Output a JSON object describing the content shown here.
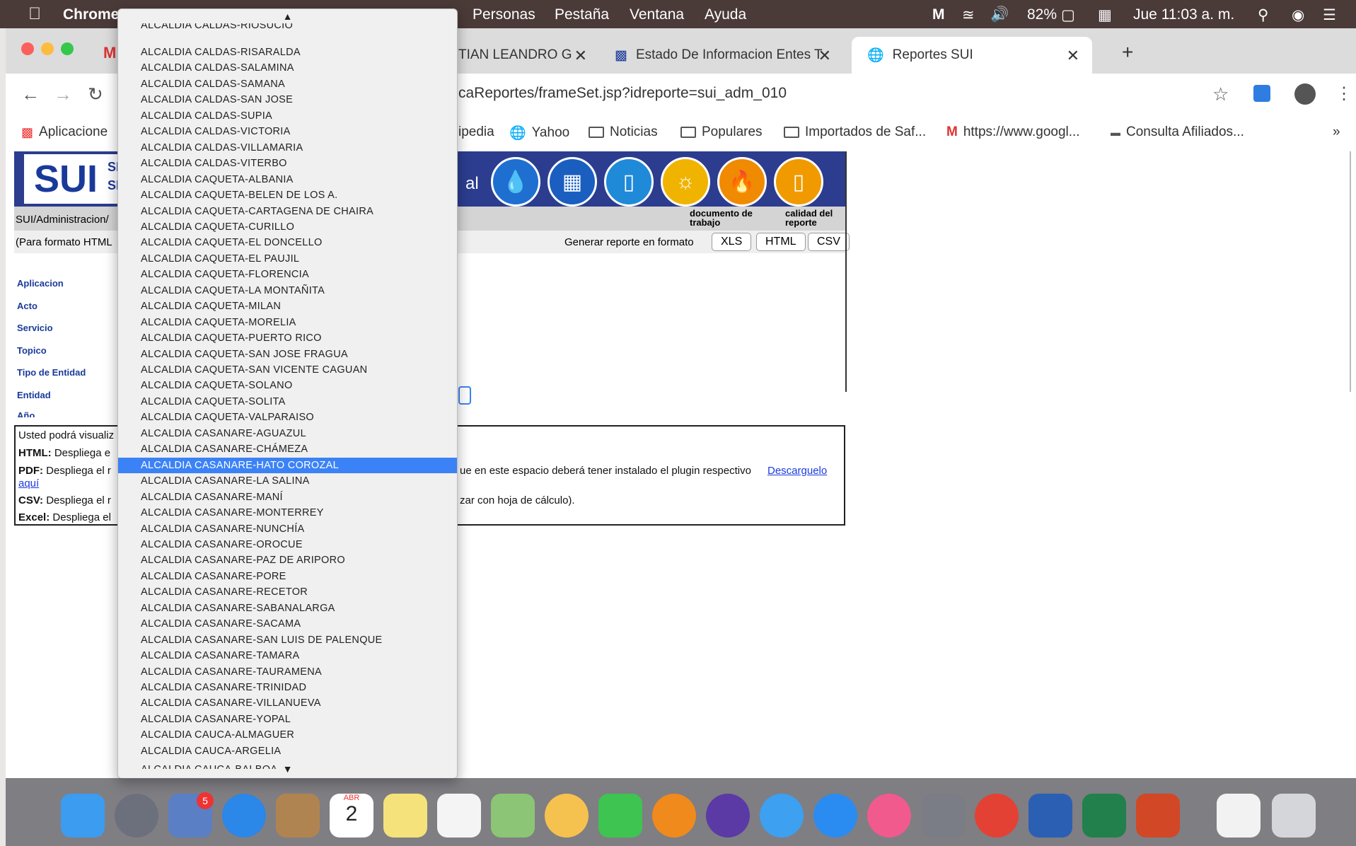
{
  "menubar": {
    "app_name": "Chrome",
    "menus": [
      "Personas",
      "Pestaña",
      "Ventana",
      "Ayuda"
    ],
    "battery": "82%",
    "datetime": "Jue 11:03 a. m."
  },
  "tabs": [
    {
      "label": "TIAN LEANDRO G"
    },
    {
      "label": "Estado De Informacion Entes T"
    },
    {
      "label": "Reportes SUI"
    }
  ],
  "address": {
    "url": "caReportes/frameSet.jsp?idreporte=sui_adm_010"
  },
  "bookmarks": [
    "Aplicacione",
    "ipedia",
    "Yahoo",
    "Noticias",
    "Populares",
    "Importados de Saf...",
    "https://www.googl...",
    "Consulta Afiliados..."
  ],
  "page": {
    "logo_text": "SUI",
    "logo_sub1": "SIS",
    "logo_sub2": "SE",
    "header_text": "al",
    "breadcrumb": "SUI/Administracion/",
    "format_note": "(Para formato HTML",
    "generate_label": "Generar reporte en formato",
    "formats": [
      "XLS",
      "HTML",
      "CSV"
    ],
    "doc_trabajo": "documento de trabajo",
    "calidad": "calidad del reporte",
    "fields": [
      "Aplicacion",
      "Acto",
      "Servicio",
      "Topico",
      "Tipo de Entidad",
      "Entidad",
      "Año"
    ],
    "info": {
      "line1": "Usted podrá visualiz",
      "html_label": "HTML:",
      "html_text": "Despliega e",
      "pdf_label": "PDF:",
      "pdf_text": "Despliega el r",
      "pdf_rest": "ue en este espacio deberá tener instalado el plugin respectivo",
      "download_link": "Descarguelo",
      "aqui_link": "aquí",
      "csv_label": "CSV:",
      "csv_text": "Despliega el r",
      "csv_rest": "zar con hoja de cálculo).",
      "excel_label": "Excel:",
      "excel_text": "Despliega el"
    }
  },
  "dropdown": {
    "top_cut": "ALCALDIA CALDAS-RIOSUCIO",
    "items": [
      "ALCALDIA CALDAS-RISARALDA",
      "ALCALDIA CALDAS-SALAMINA",
      "ALCALDIA CALDAS-SAMANA",
      "ALCALDIA CALDAS-SAN JOSE",
      "ALCALDIA CALDAS-SUPIA",
      "ALCALDIA CALDAS-VICTORIA",
      "ALCALDIA CALDAS-VILLAMARIA",
      "ALCALDIA CALDAS-VITERBO",
      "ALCALDIA CAQUETA-ALBANIA",
      "ALCALDIA CAQUETA-BELEN DE LOS A.",
      "ALCALDIA CAQUETA-CARTAGENA DE CHAIRA",
      "ALCALDIA CAQUETA-CURILLO",
      "ALCALDIA CAQUETA-EL DONCELLO",
      "ALCALDIA CAQUETA-EL PAUJIL",
      "ALCALDIA CAQUETA-FLORENCIA",
      "ALCALDIA CAQUETA-LA MONTAÑITA",
      "ALCALDIA CAQUETA-MILAN",
      "ALCALDIA CAQUETA-MORELIA",
      "ALCALDIA CAQUETA-PUERTO RICO",
      "ALCALDIA CAQUETA-SAN JOSE FRAGUA",
      "ALCALDIA CAQUETA-SAN VICENTE CAGUAN",
      "ALCALDIA CAQUETA-SOLANO",
      "ALCALDIA CAQUETA-SOLITA",
      "ALCALDIA CAQUETA-VALPARAISO",
      "ALCALDIA CASANARE-AGUAZUL",
      "ALCALDIA CASANARE-CHÁMEZA",
      "ALCALDIA CASANARE-HATO COROZAL",
      "ALCALDIA CASANARE-LA SALINA",
      "ALCALDIA CASANARE-MANÍ",
      "ALCALDIA CASANARE-MONTERREY",
      "ALCALDIA CASANARE-NUNCHÍA",
      "ALCALDIA CASANARE-OROCUE",
      "ALCALDIA CASANARE-PAZ DE ARIPORO",
      "ALCALDIA CASANARE-PORE",
      "ALCALDIA CASANARE-RECETOR",
      "ALCALDIA CASANARE-SABANALARGA",
      "ALCALDIA CASANARE-SACAMA",
      "ALCALDIA CASANARE-SAN LUIS DE PALENQUE",
      "ALCALDIA CASANARE-TAMARA",
      "ALCALDIA CASANARE-TAURAMENA",
      "ALCALDIA CASANARE-TRINIDAD",
      "ALCALDIA CASANARE-VILLANUEVA",
      "ALCALDIA CASANARE-YOPAL",
      "ALCALDIA CAUCA-ALMAGUER",
      "ALCALDIA CAUCA-ARGELIA"
    ],
    "bottom_cut": "ALCALDIA CAUCA-BALBOA",
    "selected": "ALCALDIA CASANARE-HATO COROZAL"
  },
  "dock": {
    "mail_badge": "5",
    "calendar_month": "ABR",
    "calendar_day": "2",
    "icons": [
      "finder-icon",
      "launchpad-icon",
      "mail-icon",
      "safari-icon",
      "contacts-icon",
      "calendar-icon",
      "notes-icon",
      "reminders-icon",
      "maps-icon",
      "photos-icon",
      "facetime-icon",
      "books-icon",
      "siri-icon",
      "messages-icon",
      "appstore-icon",
      "itunes-icon",
      "preferences-icon",
      "chrome-icon",
      "word-icon",
      "excel-icon",
      "powerpoint-icon",
      "excel-doc-icon",
      "trash-icon"
    ]
  }
}
